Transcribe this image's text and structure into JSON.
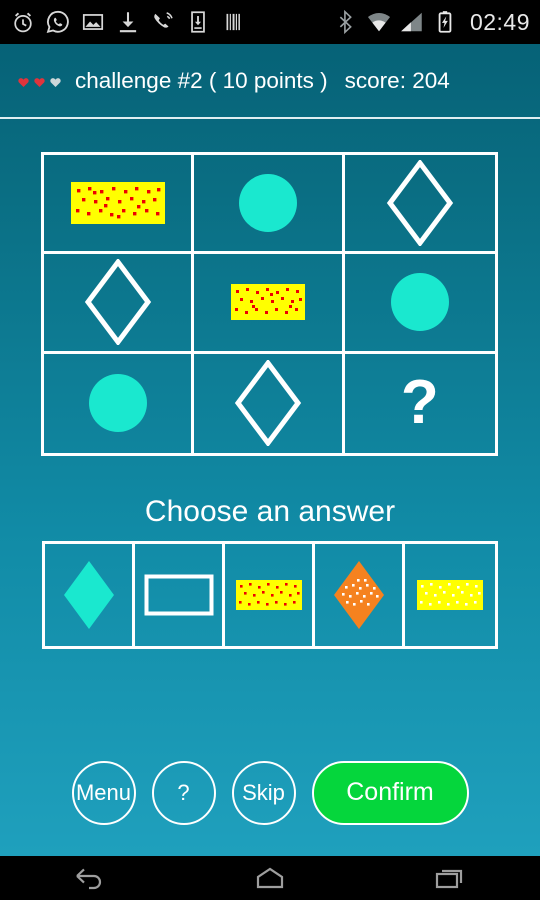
{
  "status_bar": {
    "time": "02:49",
    "left_icons": [
      "alarm-clock-icon",
      "whatsapp-icon",
      "image-icon",
      "download-icon",
      "missed-call-icon",
      "download-box-icon",
      "barcode-icon"
    ],
    "right_icons": [
      "bluetooth-icon",
      "wifi-icon",
      "cellular-signal-icon",
      "battery-charging-icon"
    ]
  },
  "header": {
    "lives": [
      {
        "name": "heart-filled",
        "color": "#e0343c"
      },
      {
        "name": "heart-filled",
        "color": "#e0343c"
      },
      {
        "name": "heart-empty",
        "color": "#cdd7d9"
      }
    ],
    "challenge_label": "challenge #2 ( 10 points )",
    "score_label": "score: 204"
  },
  "matrix": {
    "cells": [
      {
        "shape": "rectangle-yellow-red-dots",
        "label": "dotted yellow rectangle"
      },
      {
        "shape": "circle-cyan-filled",
        "label": "cyan circle"
      },
      {
        "shape": "diamond-white-outline",
        "label": "white diamond outline"
      },
      {
        "shape": "diamond-white-outline",
        "label": "white diamond outline"
      },
      {
        "shape": "rectangle-yellow-red-dots",
        "label": "dotted yellow rectangle"
      },
      {
        "shape": "circle-cyan-filled",
        "label": "cyan circle"
      },
      {
        "shape": "circle-cyan-filled",
        "label": "cyan circle"
      },
      {
        "shape": "diamond-white-outline",
        "label": "white diamond outline"
      },
      {
        "shape": "question-mark",
        "label": "?"
      }
    ],
    "missing_cell_text": "?"
  },
  "choose": {
    "prompt": "Choose an answer",
    "options": [
      {
        "shape": "diamond-cyan-filled",
        "label": "filled cyan diamond"
      },
      {
        "shape": "rectangle-white-outline",
        "label": "white rectangle outline"
      },
      {
        "shape": "rectangle-yellow-red-dots",
        "label": "yellow rectangle with red dots"
      },
      {
        "shape": "diamond-orange-white-dots",
        "label": "orange diamond with white dots"
      },
      {
        "shape": "rectangle-yellow-white-dots",
        "label": "yellow rectangle with white dots"
      }
    ]
  },
  "buttons": {
    "menu": "Menu",
    "help": "?",
    "skip": "Skip",
    "confirm": "Confirm"
  },
  "nav_bar": {
    "back": "back-icon",
    "home": "home-icon",
    "recents": "recents-icon"
  },
  "colors": {
    "bg_top": "#066277",
    "bg_bottom": "#1fa0bd",
    "cyan": "#1ae8cf",
    "yellow": "#ffff00",
    "red_dot": "#ee0000",
    "orange": "#f5821f",
    "white": "#ffffff",
    "green_confirm": "#05d63c",
    "heart_red": "#e0343c"
  }
}
